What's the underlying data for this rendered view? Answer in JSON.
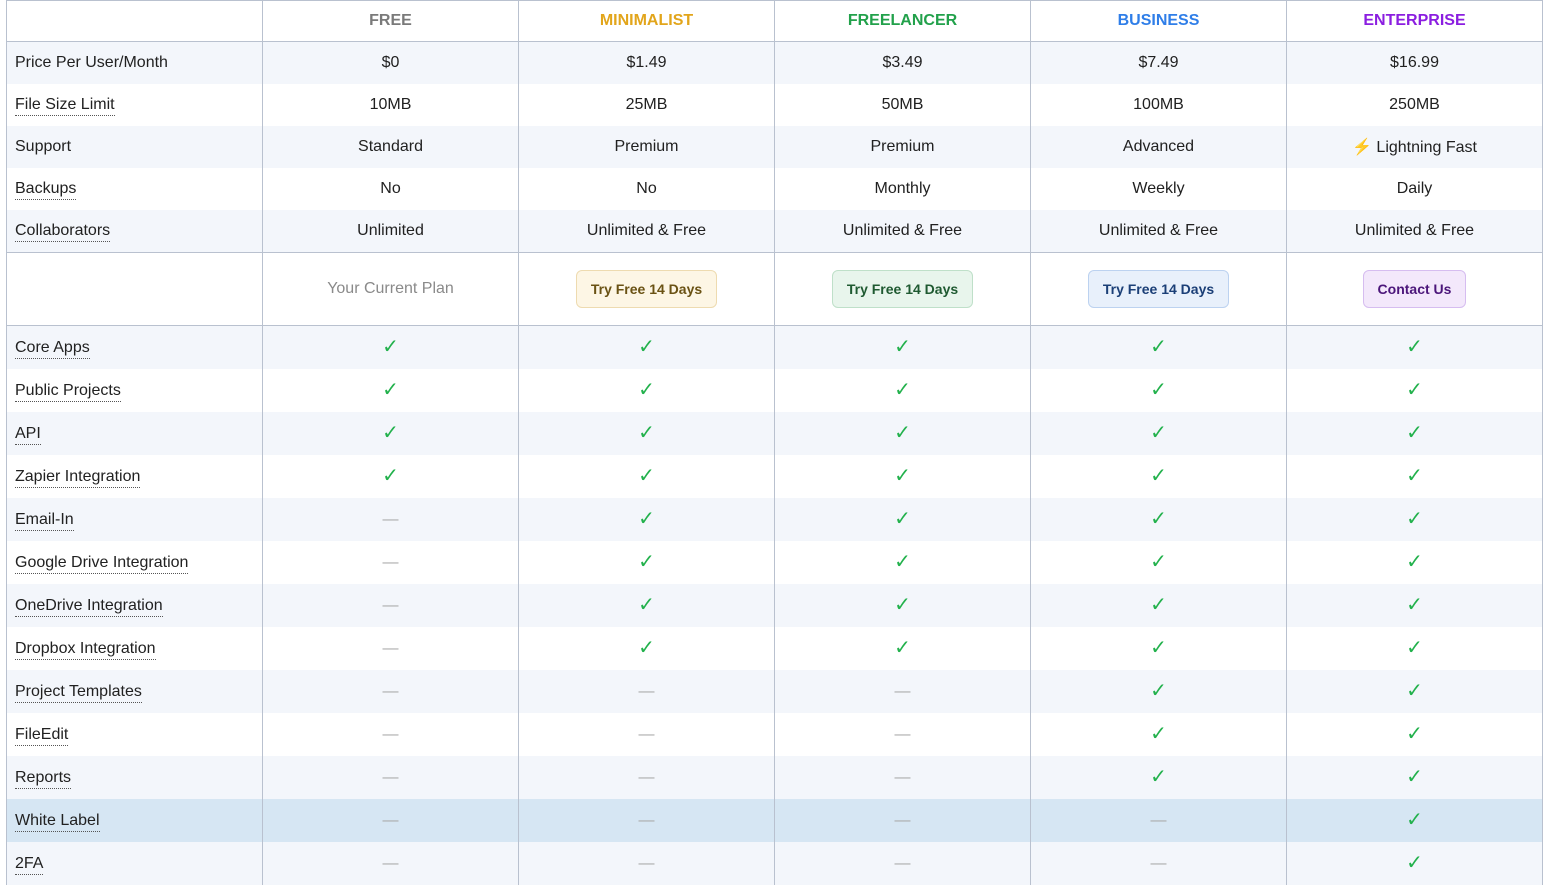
{
  "plans": [
    {
      "name": "FREE",
      "color": "#7a7a7a"
    },
    {
      "name": "MINIMALIST",
      "color": "#e2a51b"
    },
    {
      "name": "FREELANCER",
      "color": "#22a14b"
    },
    {
      "name": "BUSINESS",
      "color": "#2f7ee8"
    },
    {
      "name": "ENTERPRISE",
      "color": "#8b1ee0"
    }
  ],
  "specs": [
    {
      "label": "Price Per User/Month",
      "underline": false,
      "values": [
        "$0",
        "$1.49",
        "$3.49",
        "$7.49",
        "$16.99"
      ]
    },
    {
      "label": "File Size Limit",
      "underline": true,
      "values": [
        "10MB",
        "25MB",
        "50MB",
        "100MB",
        "250MB"
      ]
    },
    {
      "label": "Support",
      "underline": false,
      "values": [
        "Standard",
        "Premium",
        "Premium",
        "Advanced",
        "⚡ Lightning Fast"
      ]
    },
    {
      "label": "Backups",
      "underline": true,
      "values": [
        "No",
        "No",
        "Monthly",
        "Weekly",
        "Daily"
      ]
    },
    {
      "label": "Collaborators",
      "underline": true,
      "values": [
        "Unlimited",
        "Unlimited & Free",
        "Unlimited & Free",
        "Unlimited & Free",
        "Unlimited & Free"
      ]
    }
  ],
  "cta": {
    "current": "Your Current Plan",
    "minimalist": "Try Free 14 Days",
    "freelancer": "Try Free 14 Days",
    "business": "Try Free 14 Days",
    "enterprise": "Contact Us"
  },
  "features": [
    {
      "label": "Core Apps",
      "values": [
        1,
        1,
        1,
        1,
        1
      ]
    },
    {
      "label": "Public Projects",
      "values": [
        1,
        1,
        1,
        1,
        1
      ]
    },
    {
      "label": "API",
      "values": [
        1,
        1,
        1,
        1,
        1
      ]
    },
    {
      "label": "Zapier Integration",
      "values": [
        1,
        1,
        1,
        1,
        1
      ]
    },
    {
      "label": "Email-In",
      "values": [
        0,
        1,
        1,
        1,
        1
      ]
    },
    {
      "label": "Google Drive Integration",
      "values": [
        0,
        1,
        1,
        1,
        1
      ]
    },
    {
      "label": "OneDrive Integration",
      "values": [
        0,
        1,
        1,
        1,
        1
      ]
    },
    {
      "label": "Dropbox Integration",
      "values": [
        0,
        1,
        1,
        1,
        1
      ]
    },
    {
      "label": "Project Templates",
      "values": [
        0,
        0,
        0,
        1,
        1
      ]
    },
    {
      "label": "FileEdit",
      "values": [
        0,
        0,
        0,
        1,
        1
      ]
    },
    {
      "label": "Reports",
      "values": [
        0,
        0,
        0,
        1,
        1
      ]
    },
    {
      "label": "White Label",
      "values": [
        0,
        0,
        0,
        0,
        1
      ],
      "highlight": true
    },
    {
      "label": "2FA",
      "values": [
        0,
        0,
        0,
        0,
        1
      ]
    }
  ],
  "symbols": {
    "check": "✓",
    "dash": "—"
  }
}
